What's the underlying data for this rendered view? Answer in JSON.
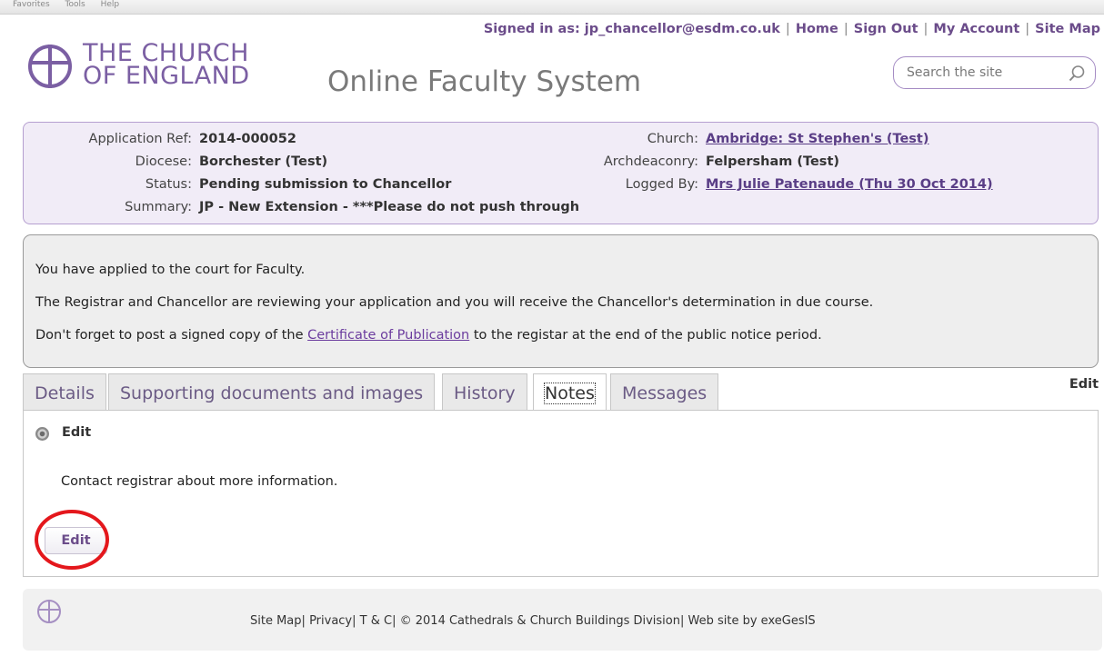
{
  "browser_menu": [
    "Favorites",
    "Tools",
    "Help"
  ],
  "top_nav": {
    "signed_in": "Signed in as: jp_chancellor@esdm.co.uk",
    "home": "Home",
    "sign_out": "Sign Out",
    "my_account": "My Account",
    "site_map": "Site Map",
    "separator": "|"
  },
  "brand": {
    "logo_line1": "THE CHURCH",
    "logo_line2": "OF ENGLAND",
    "site_title": "Online Faculty System",
    "accent_color": "#7b5fa3"
  },
  "search": {
    "placeholder": "Search the site",
    "icon": "search-icon"
  },
  "application": {
    "ref_label": "Application Ref:",
    "ref_value": "2014-000052",
    "diocese_label": "Diocese:",
    "diocese_value": "Borchester (Test)",
    "status_label": "Status:",
    "status_value": "Pending submission to Chancellor",
    "summary_label": "Summary:",
    "summary_value": "JP - New Extension - ***Please do not push through",
    "church_label": "Church:",
    "church_value": "Ambridge: St Stephen's (Test)",
    "archdeaconry_label": "Archdeaconry:",
    "archdeaconry_value": "Felpersham (Test)",
    "logged_by_label": "Logged By:",
    "logged_by_value": "Mrs Julie Patenaude (Thu 30 Oct 2014)"
  },
  "message": {
    "line1": "You have applied to the court for Faculty.",
    "line2": "The Registrar and Chancellor are reviewing your application and you will receive the Chancellor's determination in due course.",
    "line3_before": "Don't forget to post a signed copy of the ",
    "line3_link": "Certificate of Publication",
    "line3_after": " to the registar at the end of the public notice period."
  },
  "tabs": [
    {
      "label": "Details",
      "active": false
    },
    {
      "label": "Supporting documents and images",
      "active": false
    },
    {
      "label": "History",
      "active": false
    },
    {
      "label": "Notes",
      "active": true
    },
    {
      "label": "Messages",
      "active": false
    }
  ],
  "tab_area_edit": "Edit",
  "notes": {
    "section_label": "Edit",
    "text": "Contact registrar about more information.",
    "button_label": "Edit",
    "highlight_color": "#e4171c"
  },
  "footer": {
    "site_map": "Site Map",
    "privacy": "Privacy",
    "tc": "T & C",
    "copyright": "© 2014 Cathedrals & Church Buildings Division",
    "credit": "Web site by exeGesIS",
    "separator": "|"
  }
}
